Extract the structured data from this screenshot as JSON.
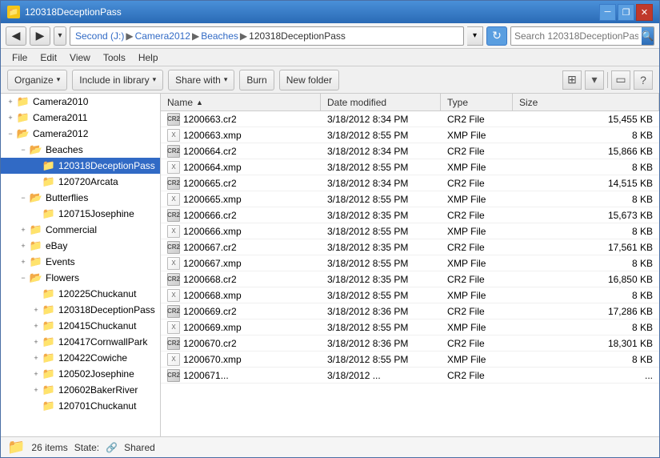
{
  "window": {
    "title": "120318DeceptionPass",
    "title_icon": "📁",
    "controls": {
      "minimize": "─",
      "maximize": "□",
      "restore": "❐",
      "close": "✕"
    }
  },
  "address_bar": {
    "back_tooltip": "Back",
    "forward_tooltip": "Forward",
    "path_parts": [
      "Second (J:)",
      "Camera2012",
      "Beaches",
      "120318DeceptionPass"
    ],
    "refresh_label": "↻",
    "search_placeholder": "Search 120318DeceptionPass",
    "search_icon": "🔍"
  },
  "menu": {
    "items": [
      "File",
      "Edit",
      "View",
      "Tools",
      "Help"
    ]
  },
  "toolbar": {
    "organize_label": "Organize",
    "include_library_label": "Include in library",
    "share_with_label": "Share with",
    "burn_label": "Burn",
    "new_folder_label": "New folder",
    "view_icon": "≡",
    "view_options_icon": "▾",
    "layout_icon": "⊞",
    "help_icon": "?"
  },
  "nav_tree": {
    "items": [
      {
        "id": "camera2010",
        "label": "Camera2010",
        "indent": 0,
        "expanded": false,
        "has_children": true
      },
      {
        "id": "camera2011",
        "label": "Camera2011",
        "indent": 0,
        "expanded": false,
        "has_children": true
      },
      {
        "id": "camera2012",
        "label": "Camera2012",
        "indent": 0,
        "expanded": true,
        "has_children": true
      },
      {
        "id": "beaches",
        "label": "Beaches",
        "indent": 1,
        "expanded": true,
        "has_children": true
      },
      {
        "id": "120318deceptionpass",
        "label": "120318DeceptionPass",
        "indent": 2,
        "expanded": false,
        "has_children": false,
        "selected": true
      },
      {
        "id": "120720arcata",
        "label": "120720Arcata",
        "indent": 2,
        "expanded": false,
        "has_children": false
      },
      {
        "id": "butterflies",
        "label": "Butterflies",
        "indent": 1,
        "expanded": true,
        "has_children": true
      },
      {
        "id": "120715josephine",
        "label": "120715Josephine",
        "indent": 2,
        "expanded": false,
        "has_children": false
      },
      {
        "id": "commercial",
        "label": "Commercial",
        "indent": 1,
        "expanded": false,
        "has_children": true
      },
      {
        "id": "ebay",
        "label": "eBay",
        "indent": 1,
        "expanded": false,
        "has_children": true
      },
      {
        "id": "events",
        "label": "Events",
        "indent": 1,
        "expanded": false,
        "has_children": true
      },
      {
        "id": "flowers",
        "label": "Flowers",
        "indent": 1,
        "expanded": true,
        "has_children": true
      },
      {
        "id": "120225chuckanut",
        "label": "120225Chuckanut",
        "indent": 2,
        "expanded": false,
        "has_children": false
      },
      {
        "id": "120318deceptionpass2",
        "label": "120318DeceptionPass",
        "indent": 2,
        "expanded": false,
        "has_children": true
      },
      {
        "id": "120415chuckanut",
        "label": "120415Chuckanut",
        "indent": 2,
        "expanded": false,
        "has_children": true
      },
      {
        "id": "120417cornwallpark",
        "label": "120417CornwallPark",
        "indent": 2,
        "expanded": false,
        "has_children": true
      },
      {
        "id": "120422cowiche",
        "label": "120422Cowiche",
        "indent": 2,
        "expanded": false,
        "has_children": true
      },
      {
        "id": "120502josephine",
        "label": "120502Josephine",
        "indent": 2,
        "expanded": false,
        "has_children": true
      },
      {
        "id": "120602bakerriver",
        "label": "120602BakerRiver",
        "indent": 2,
        "expanded": false,
        "has_children": true
      },
      {
        "id": "120701chuckanut",
        "label": "120701Chuckanut",
        "indent": 2,
        "expanded": false,
        "has_children": false
      }
    ]
  },
  "file_list": {
    "columns": [
      {
        "id": "name",
        "label": "Name",
        "sort": "asc"
      },
      {
        "id": "date_modified",
        "label": "Date modified",
        "sort": null
      },
      {
        "id": "type",
        "label": "Type",
        "sort": null
      },
      {
        "id": "size",
        "label": "Size",
        "sort": null
      }
    ],
    "files": [
      {
        "name": "1200663.cr2",
        "date": "3/18/2012 8:34 PM",
        "type": "CR2 File",
        "size": "15,455 KB",
        "icon": "cr2"
      },
      {
        "name": "1200663.xmp",
        "date": "3/18/2012 8:55 PM",
        "type": "XMP File",
        "size": "8 KB",
        "icon": "xmp"
      },
      {
        "name": "1200664.cr2",
        "date": "3/18/2012 8:34 PM",
        "type": "CR2 File",
        "size": "15,866 KB",
        "icon": "cr2"
      },
      {
        "name": "1200664.xmp",
        "date": "3/18/2012 8:55 PM",
        "type": "XMP File",
        "size": "8 KB",
        "icon": "xmp"
      },
      {
        "name": "1200665.cr2",
        "date": "3/18/2012 8:34 PM",
        "type": "CR2 File",
        "size": "14,515 KB",
        "icon": "cr2"
      },
      {
        "name": "1200665.xmp",
        "date": "3/18/2012 8:55 PM",
        "type": "XMP File",
        "size": "8 KB",
        "icon": "xmp"
      },
      {
        "name": "1200666.cr2",
        "date": "3/18/2012 8:35 PM",
        "type": "CR2 File",
        "size": "15,673 KB",
        "icon": "cr2"
      },
      {
        "name": "1200666.xmp",
        "date": "3/18/2012 8:55 PM",
        "type": "XMP File",
        "size": "8 KB",
        "icon": "xmp"
      },
      {
        "name": "1200667.cr2",
        "date": "3/18/2012 8:35 PM",
        "type": "CR2 File",
        "size": "17,561 KB",
        "icon": "cr2"
      },
      {
        "name": "1200667.xmp",
        "date": "3/18/2012 8:55 PM",
        "type": "XMP File",
        "size": "8 KB",
        "icon": "xmp"
      },
      {
        "name": "1200668.cr2",
        "date": "3/18/2012 8:35 PM",
        "type": "CR2 File",
        "size": "16,850 KB",
        "icon": "cr2"
      },
      {
        "name": "1200668.xmp",
        "date": "3/18/2012 8:55 PM",
        "type": "XMP File",
        "size": "8 KB",
        "icon": "xmp"
      },
      {
        "name": "1200669.cr2",
        "date": "3/18/2012 8:36 PM",
        "type": "CR2 File",
        "size": "17,286 KB",
        "icon": "cr2"
      },
      {
        "name": "1200669.xmp",
        "date": "3/18/2012 8:55 PM",
        "type": "XMP File",
        "size": "8 KB",
        "icon": "xmp"
      },
      {
        "name": "1200670.cr2",
        "date": "3/18/2012 8:36 PM",
        "type": "CR2 File",
        "size": "18,301 KB",
        "icon": "cr2"
      },
      {
        "name": "1200670.xmp",
        "date": "3/18/2012 8:55 PM",
        "type": "XMP File",
        "size": "8 KB",
        "icon": "xmp"
      },
      {
        "name": "1200671...",
        "date": "3/18/2012 ...",
        "type": "CR2 File",
        "size": "...",
        "icon": "cr2"
      }
    ]
  },
  "status_bar": {
    "item_count": "26 items",
    "state_label": "State:",
    "state_value": "Shared",
    "state_icon": "🔗"
  }
}
